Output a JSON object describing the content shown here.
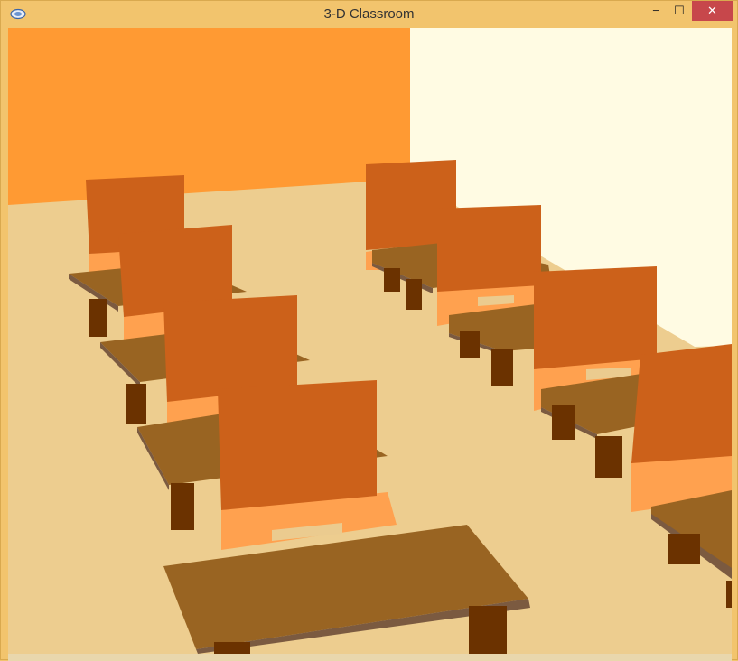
{
  "window": {
    "title": "3-D Classroom",
    "controls": {
      "minimize": "−",
      "maximize": "☐",
      "close": "✕"
    },
    "icon": "app-icon"
  },
  "scene": {
    "colors": {
      "wall_left": "#ff9a33",
      "wall_right": "#fffbe3",
      "floor": "#edcd8f",
      "chair_back": "#cc611a",
      "chair_seat": "#ffa14f",
      "chair_seat_gap": "#ebcb8f",
      "desk_top": "#996422",
      "desk_edge": "#7b5a40",
      "desk_leg": "#6b3200"
    }
  }
}
